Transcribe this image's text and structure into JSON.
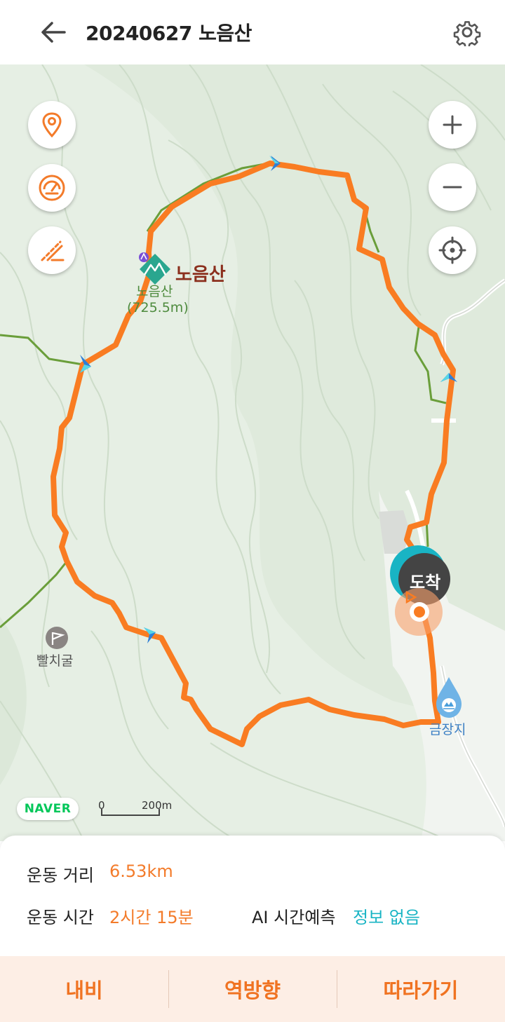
{
  "header": {
    "title": "20240627 노음산",
    "back_icon": "back-arrow-icon",
    "settings_icon": "gear-icon"
  },
  "map": {
    "left_controls": [
      {
        "icon": "location-pin-icon"
      },
      {
        "icon": "speedometer-icon"
      },
      {
        "icon": "elevation-slope-icon"
      }
    ],
    "right_controls": [
      {
        "icon": "zoom-in-icon"
      },
      {
        "icon": "zoom-out-icon"
      },
      {
        "icon": "crosshair-location-icon"
      }
    ],
    "peak": {
      "label": "노음산",
      "sub_label": "노음산",
      "elevation": "(725.5m)"
    },
    "cave_label": "빨치굴",
    "reservoir_label": "금장지",
    "arrival_label": "도착",
    "naver_logo": "NAVER",
    "scale": {
      "start": "0",
      "end": "200m"
    },
    "colors": {
      "route": "#f97c22",
      "trail": "#6a9e3a",
      "arrival_marker": "#19b4c4"
    }
  },
  "stats": {
    "distance_label": "운동 거리",
    "distance_value": "6.53km",
    "time_label": "운동 시간",
    "time_value": "2시간 15분",
    "ai_label": "AI 시간예측",
    "ai_value": "정보 없음"
  },
  "actions": {
    "navi": "내비",
    "reverse": "역방향",
    "follow": "따라가기"
  }
}
